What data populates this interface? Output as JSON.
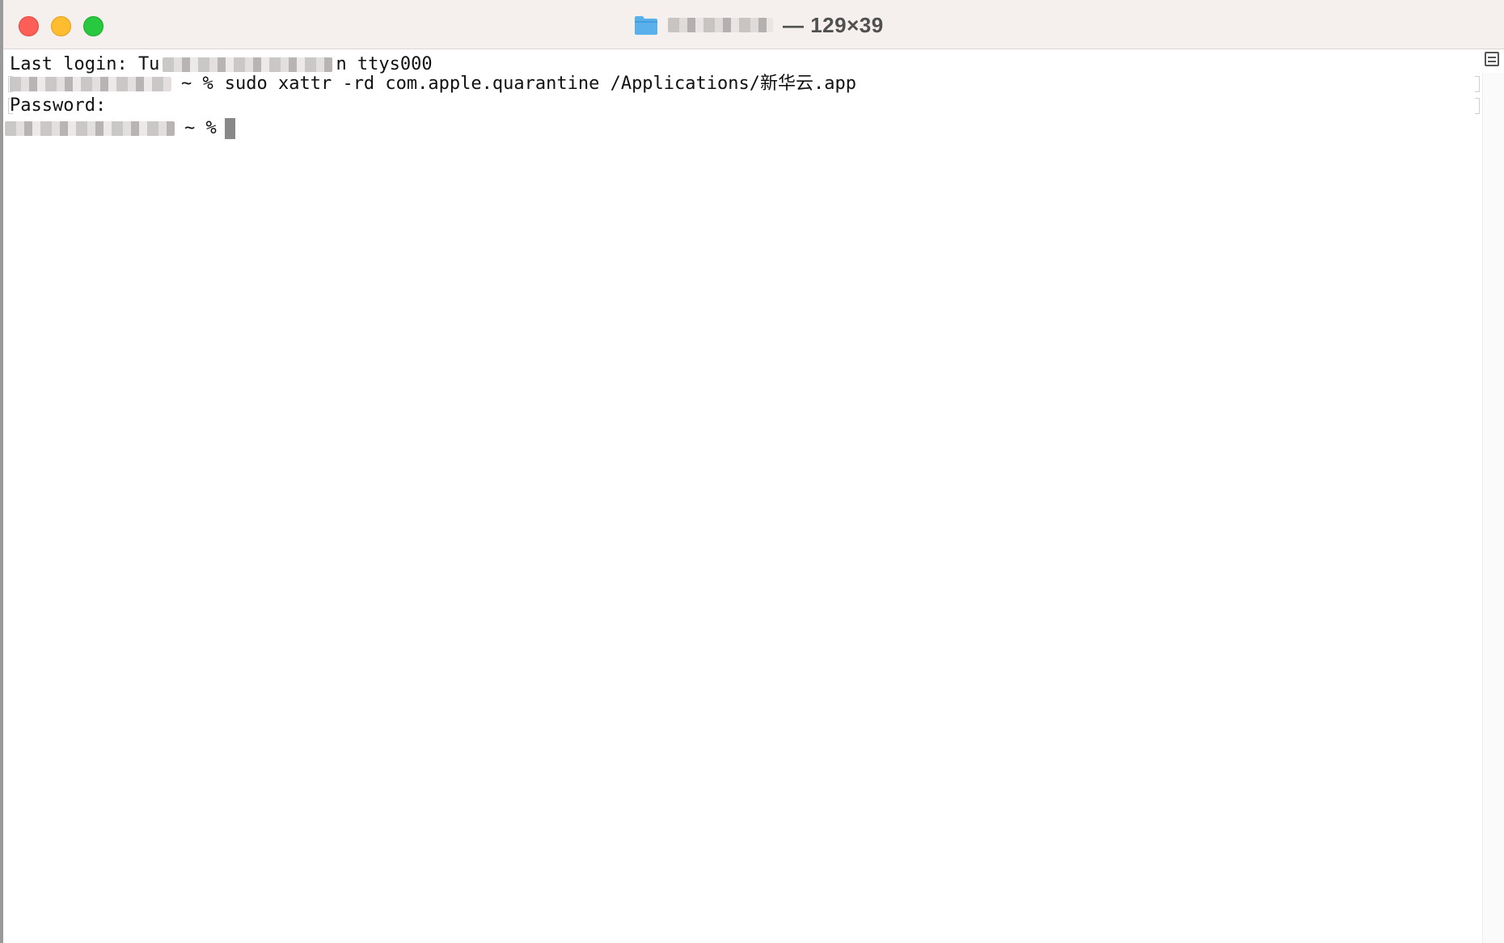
{
  "window": {
    "title_suffix": "— 129×39",
    "icon": "folder-icon"
  },
  "terminal": {
    "lines": [
      {
        "before": "Last login: Tu",
        "after": "n ttys000"
      },
      {
        "prompt": "~ %",
        "command": "sudo xattr -rd com.apple.quarantine /Applications/新华云.app"
      },
      {
        "text": "Password:"
      },
      {
        "prompt": "~ %"
      }
    ]
  },
  "colors": {
    "titlebar": "#f5efed",
    "close": "#ff5f57",
    "minimize": "#febc2e",
    "zoom": "#28c840",
    "folder": "#5ab0ea",
    "cursor": "#888888"
  }
}
